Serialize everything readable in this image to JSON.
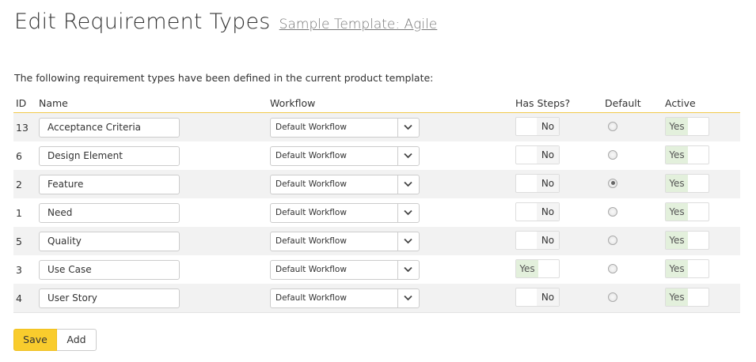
{
  "page": {
    "title": "Edit Requirement Types",
    "template_link": "Sample Template: Agile",
    "intro": "The following requirement types have been defined in the current product template:"
  },
  "table": {
    "headers": {
      "id": "ID",
      "name": "Name",
      "workflow": "Workflow",
      "has_steps": "Has Steps?",
      "default": "Default",
      "active": "Active"
    },
    "rows": [
      {
        "id": "13",
        "name": "Acceptance Criteria",
        "workflow": "Default Workflow",
        "has_steps": "No",
        "default": false,
        "active": "Yes"
      },
      {
        "id": "6",
        "name": "Design Element",
        "workflow": "Default Workflow",
        "has_steps": "No",
        "default": false,
        "active": "Yes"
      },
      {
        "id": "2",
        "name": "Feature",
        "workflow": "Default Workflow",
        "has_steps": "No",
        "default": true,
        "active": "Yes"
      },
      {
        "id": "1",
        "name": "Need",
        "workflow": "Default Workflow",
        "has_steps": "No",
        "default": false,
        "active": "Yes"
      },
      {
        "id": "5",
        "name": "Quality",
        "workflow": "Default Workflow",
        "has_steps": "No",
        "default": false,
        "active": "Yes"
      },
      {
        "id": "3",
        "name": "Use Case",
        "workflow": "Default Workflow",
        "has_steps": "Yes",
        "default": false,
        "active": "Yes"
      },
      {
        "id": "4",
        "name": "User Story",
        "workflow": "Default Workflow",
        "has_steps": "No",
        "default": false,
        "active": "Yes"
      }
    ]
  },
  "buttons": {
    "save": "Save",
    "add": "Add"
  },
  "icons": {
    "dropdown": "chevron-down-icon"
  },
  "colors": {
    "accent": "#f9cc2d",
    "header_rule": "#f2c94c",
    "toggle_on": "#e3f0dc",
    "row_stripe": "#f2f2f2"
  }
}
